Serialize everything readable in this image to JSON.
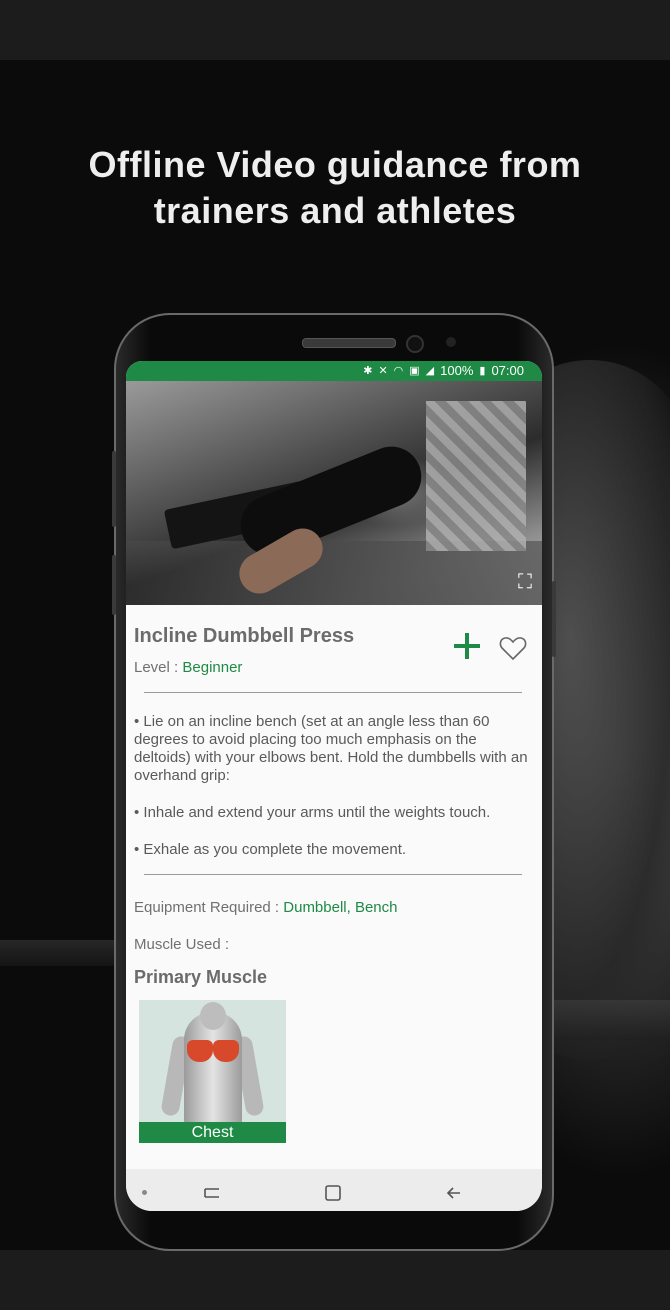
{
  "headline": {
    "line1": "Offline Video guidance from",
    "line2": "trainers and athletes"
  },
  "status_bar": {
    "battery": "100%",
    "time": "07:00",
    "icons": [
      "bluetooth-icon",
      "mute-icon",
      "wifi-icon",
      "signal-icon",
      "battery-icon"
    ]
  },
  "exercise": {
    "title": "Incline Dumbbell Press",
    "level_label": "Level : ",
    "level_value": "Beginner",
    "add_icon": "plus-icon",
    "favorite_icon": "heart-icon",
    "instructions": [
      "• Lie on an incline bench (set at an angle less than 60 degrees to avoid placing too much emphasis on the deltoids) with your elbows bent. Hold the dumbbells with an overhand grip:",
      "• Inhale and extend your arms until the weights touch.",
      "• Exhale as you complete the movement."
    ],
    "equipment_label": "Equipment Required : ",
    "equipment_value": "Dumbbell, Bench",
    "muscle_used_label": "Muscle Used :",
    "primary_muscle_heading": "Primary Muscle",
    "primary_muscle": "Chest"
  },
  "colors": {
    "accent": "#1e8a45",
    "background": "#1c1c1c"
  },
  "nav": {
    "icons": [
      "recents-icon",
      "home-icon",
      "back-icon"
    ]
  }
}
